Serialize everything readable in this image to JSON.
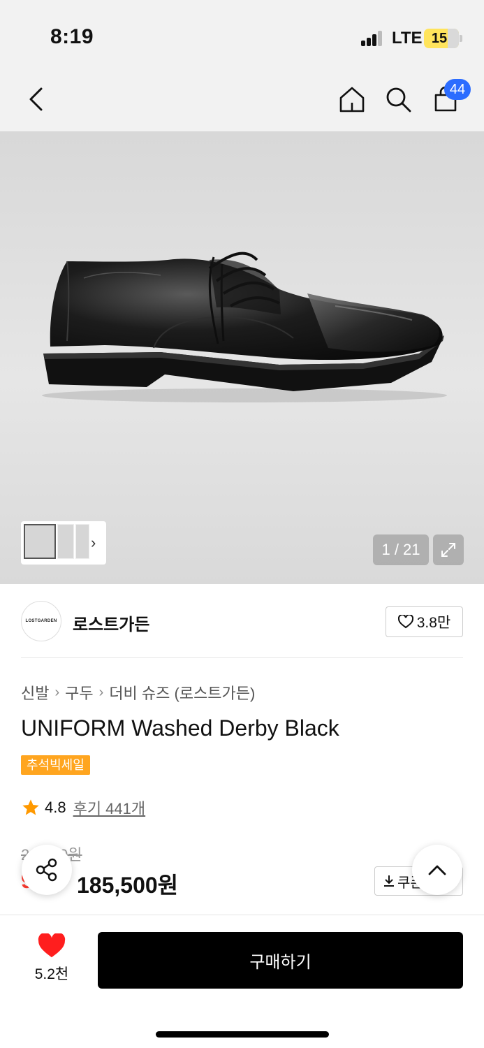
{
  "status": {
    "time": "8:19",
    "network": "LTE",
    "battery": "15"
  },
  "nav": {
    "cart_count": "44"
  },
  "gallery": {
    "counter": "1 / 21"
  },
  "brand": {
    "logo_text": "LOSTGARDEN",
    "name": "로스트가든",
    "likes": "3.8만"
  },
  "product": {
    "breadcrumb": [
      "신발",
      "구두",
      "더비 슈즈 (로스트가든)"
    ],
    "title": "UNIFORM Washed Derby Black",
    "badge": "추석빅세일",
    "rating": "4.8",
    "reviews": "후기 441개",
    "original_price": "20 000원",
    "discount": "9%",
    "price": "185,500원",
    "coupon_label": "쿠폰"
  },
  "bottom": {
    "wish_count": "5.2천",
    "buy_label": "구매하기"
  },
  "colors": {
    "accent_blue": "#2b6cff",
    "sale_orange": "#ffa51f",
    "discount_red": "#ff3a2f",
    "heart_red": "#ff1e1e"
  }
}
